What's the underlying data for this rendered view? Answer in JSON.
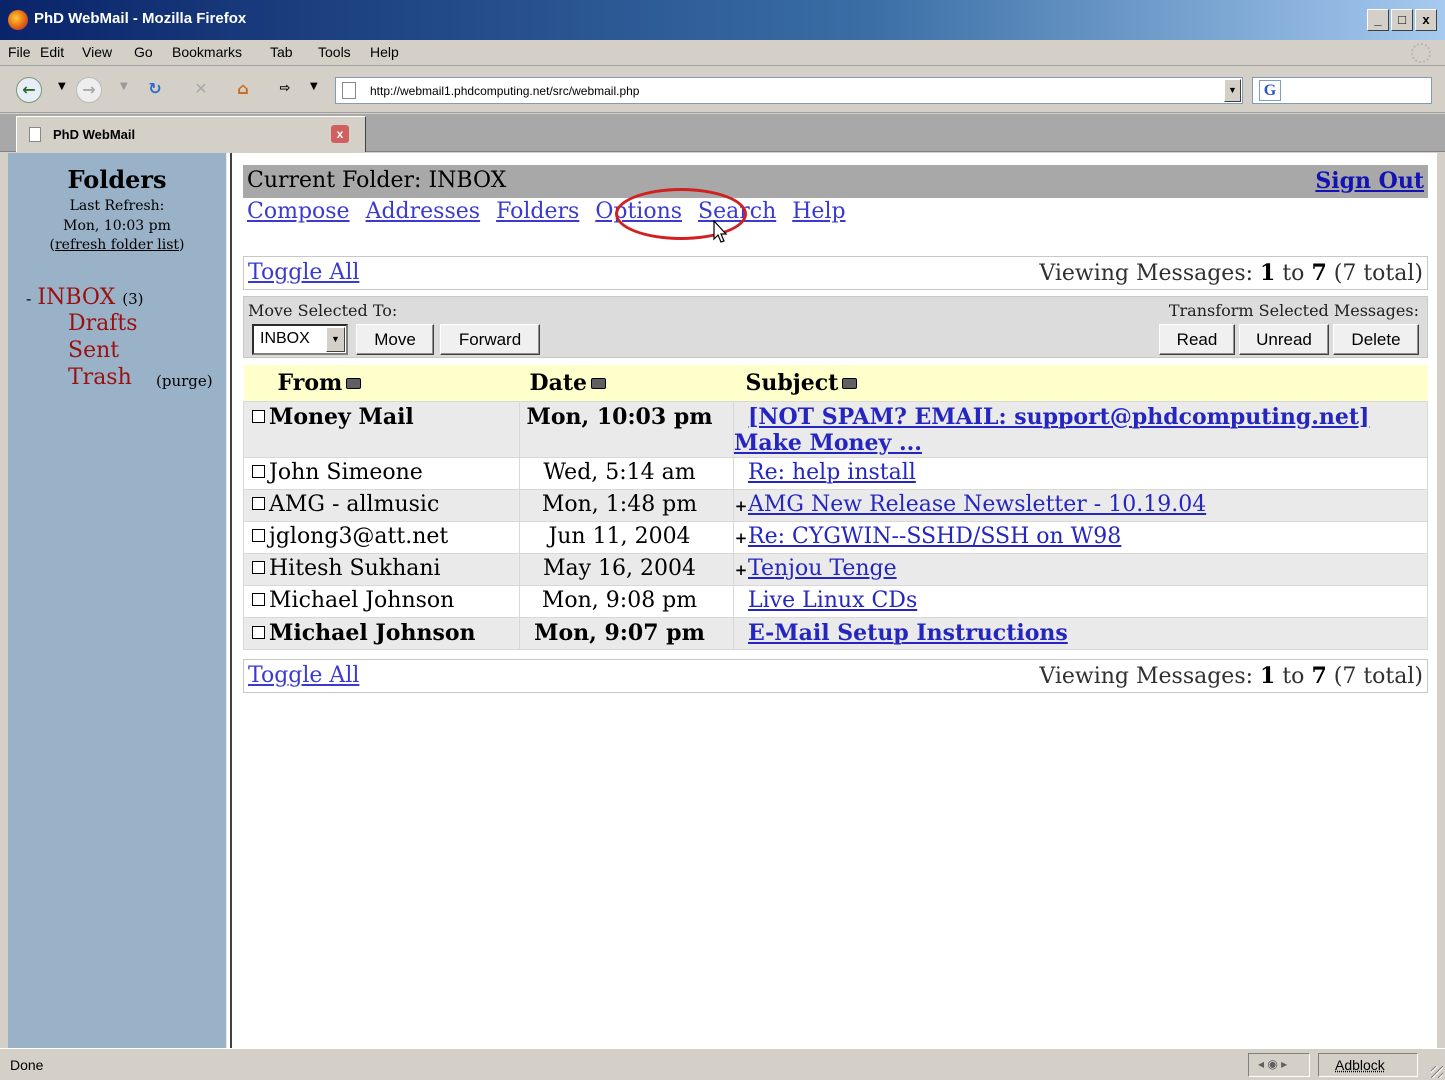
{
  "window": {
    "title": "PhD WebMail - Mozilla Firefox",
    "btn_min": "_",
    "btn_max": "□",
    "btn_close": "x"
  },
  "menu": [
    "File",
    "Edit",
    "View",
    "Go",
    "Bookmarks",
    "Tab",
    "Tools",
    "Help"
  ],
  "nav": {
    "url": "http://webmail1.phdcomputing.net/src/webmail.php",
    "search_engine": "G"
  },
  "tab": {
    "title": "PhD WebMail",
    "close": "x"
  },
  "sidebar": {
    "title": "Folders",
    "last_refresh_label": "Last Refresh:",
    "last_refresh_time": "Mon, 10:03 pm",
    "refresh_link": "refresh folder list",
    "folders": [
      {
        "name": "INBOX",
        "count": "(3)"
      },
      {
        "name": "Drafts"
      },
      {
        "name": "Sent"
      },
      {
        "name": "Trash",
        "action": "(purge)"
      }
    ]
  },
  "main": {
    "current_folder_label": "Current Folder:",
    "current_folder": "INBOX",
    "sign_out": "Sign Out",
    "links": [
      "Compose",
      "Addresses",
      "Folders",
      "Options",
      "Search",
      "Help"
    ],
    "toggle_all": "Toggle All",
    "viewing": {
      "prefix": "Viewing Messages:",
      "from": "1",
      "to_word": "to",
      "to": "7",
      "total": "(7 total)"
    },
    "move_selected_label": "Move Selected To:",
    "transform_label": "Transform Selected Messages:",
    "move_target": "INBOX",
    "buttons": {
      "move": "Move",
      "forward": "Forward",
      "read": "Read",
      "unread": "Unread",
      "delete": "Delete"
    },
    "columns": {
      "from": "From",
      "date": "Date",
      "subject": "Subject"
    },
    "messages": [
      {
        "from": "Money Mail",
        "date": "Mon, 10:03 pm",
        "subject": "[NOT SPAM? EMAIL: support@phdcomputing.net] Make Money ...",
        "flag": "",
        "bold": true
      },
      {
        "from": "John Simeone",
        "date": "Wed, 5:14 am",
        "subject": "Re: help install",
        "flag": "",
        "bold": false
      },
      {
        "from": "AMG - allmusic",
        "date": "Mon, 1:48 pm",
        "subject": "AMG New Release Newsletter - 10.19.04",
        "flag": "+",
        "bold": false
      },
      {
        "from": "jglong3@att.net",
        "date": "Jun 11, 2004",
        "subject": "Re: CYGWIN--SSHD/SSH on W98",
        "flag": "+",
        "bold": false
      },
      {
        "from": "Hitesh Sukhani",
        "date": "May 16, 2004",
        "subject": "Tenjou Tenge",
        "flag": "+",
        "bold": false
      },
      {
        "from": "Michael Johnson",
        "date": "Mon, 9:08 pm",
        "subject": "Live Linux CDs",
        "flag": "",
        "bold": false
      },
      {
        "from": "Michael Johnson",
        "date": "Mon, 9:07 pm",
        "subject": "E-Mail Setup Instructions",
        "flag": "",
        "bold": true
      }
    ]
  },
  "status": {
    "text": "Done",
    "adblock": "Adblock"
  },
  "colors": {
    "sidebar_bg": "#9ab2c8",
    "folder_link": "#9a1010",
    "link": "#3a3ad0",
    "header_bg": "#ffffcc",
    "highlight_ring": "#d02020"
  }
}
